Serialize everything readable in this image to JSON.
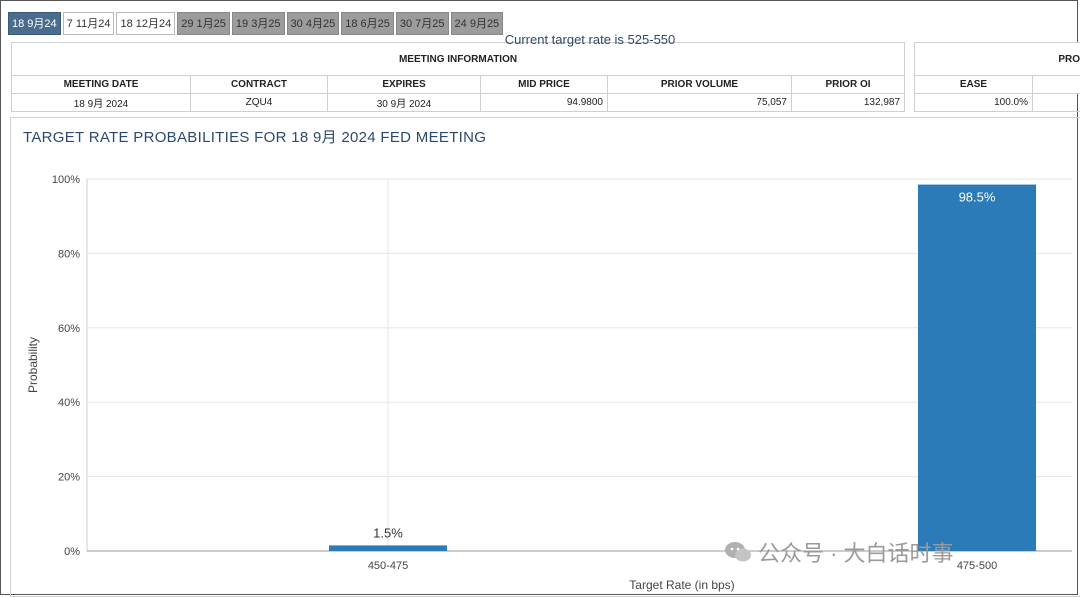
{
  "tabs": [
    {
      "label": "18 9月24",
      "state": "active"
    },
    {
      "label": "7 11月24",
      "state": "normal"
    },
    {
      "label": "18 12月24",
      "state": "normal"
    },
    {
      "label": "29 1月25",
      "state": "gray"
    },
    {
      "label": "19 3月25",
      "state": "gray"
    },
    {
      "label": "30 4月25",
      "state": "gray"
    },
    {
      "label": "18 6月25",
      "state": "gray"
    },
    {
      "label": "30 7月25",
      "state": "gray"
    },
    {
      "label": "24 9月25",
      "state": "gray"
    }
  ],
  "meeting_info": {
    "title": "MEETING INFORMATION",
    "headers": [
      "MEETING DATE",
      "CONTRACT",
      "EXPIRES",
      "MID PRICE",
      "PRIOR VOLUME",
      "PRIOR OI"
    ],
    "row": [
      "18 9月 2024",
      "ZQU4",
      "30 9月 2024",
      "94.9800",
      "75,057",
      "132,987"
    ]
  },
  "prob_info": {
    "title": "PRO",
    "headers": [
      "EASE"
    ],
    "row": [
      "100.0%"
    ]
  },
  "chart_data": {
    "type": "bar",
    "title": "TARGET RATE PROBABILITIES FOR 18 9月 2024 FED MEETING",
    "subtitle": "Current target rate is 525-550",
    "xlabel": "Target Rate (in bps)",
    "ylabel": "Probability",
    "categories": [
      "450-475",
      "475-500"
    ],
    "values": [
      1.5,
      98.5
    ],
    "data_labels": [
      "1.5%",
      "98.5%"
    ],
    "ylim": [
      0,
      100
    ],
    "y_ticks": [
      0,
      20,
      40,
      60,
      80,
      100
    ],
    "y_tick_labels": [
      "0%",
      "20%",
      "40%",
      "60%",
      "80%",
      "100%"
    ],
    "grid": true,
    "bar_color": "#2b7bb9"
  },
  "watermark": {
    "text": "公众号 · 大白话时事",
    "icon": "wechat-icon"
  }
}
